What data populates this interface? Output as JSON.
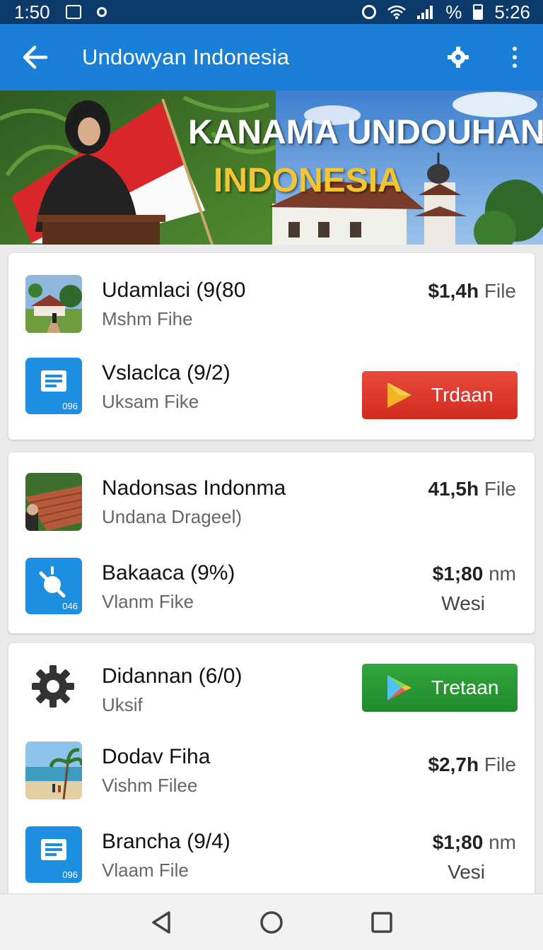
{
  "status_bar": {
    "time_left": "1:50",
    "battery_label": "%",
    "time_right": "5:26"
  },
  "app_bar": {
    "title": "Undowyan Indonesia"
  },
  "banner": {
    "title": "KANAMA UNDOUHAN",
    "subtitle": "INDONESIA"
  },
  "cards": [
    {
      "rows": [
        {
          "title": "Udamlaci (9(80",
          "subtitle": "Mshm Fihe",
          "meta_bold": "$1,4h",
          "meta_light": "File",
          "icon": "building-thumbnail"
        },
        {
          "title": "Vslaclca (9/2)",
          "subtitle": "Uksam Fike",
          "icon": "document-icon",
          "icon_tag": "096",
          "button_label": "Trdaan",
          "button_color": "#d9342a"
        }
      ]
    },
    {
      "rows": [
        {
          "title": "Nadonsas Indonma",
          "subtitle": "Undana Drageel)",
          "meta_bold": "41,5h",
          "meta_light": "File",
          "icon": "roof-thumbnail"
        },
        {
          "title": "Bakaaca (9%)",
          "subtitle": "Vlanm Fike",
          "meta_bold": "$1;80",
          "meta_light": "nm",
          "meta_line2": "Wesi",
          "icon": "tool-icon",
          "icon_tag": "046"
        }
      ]
    },
    {
      "rows": [
        {
          "title": "Didannan (6/0)",
          "subtitle": "Uksif",
          "icon": "gear-icon",
          "button_label": "Tretaan",
          "button_color": "#2a9834"
        },
        {
          "title": "Dodav Fiha",
          "subtitle": "Vishm Filee",
          "meta_bold": "$2,7h",
          "meta_light": "File",
          "icon": "beach-thumbnail"
        },
        {
          "title": "Brancha (9/4)",
          "subtitle": "Vlaam File",
          "meta_bold": "$1;80",
          "meta_light": "nm",
          "meta_line2": "Vesi",
          "icon": "document-icon",
          "icon_tag": "096"
        }
      ]
    }
  ]
}
